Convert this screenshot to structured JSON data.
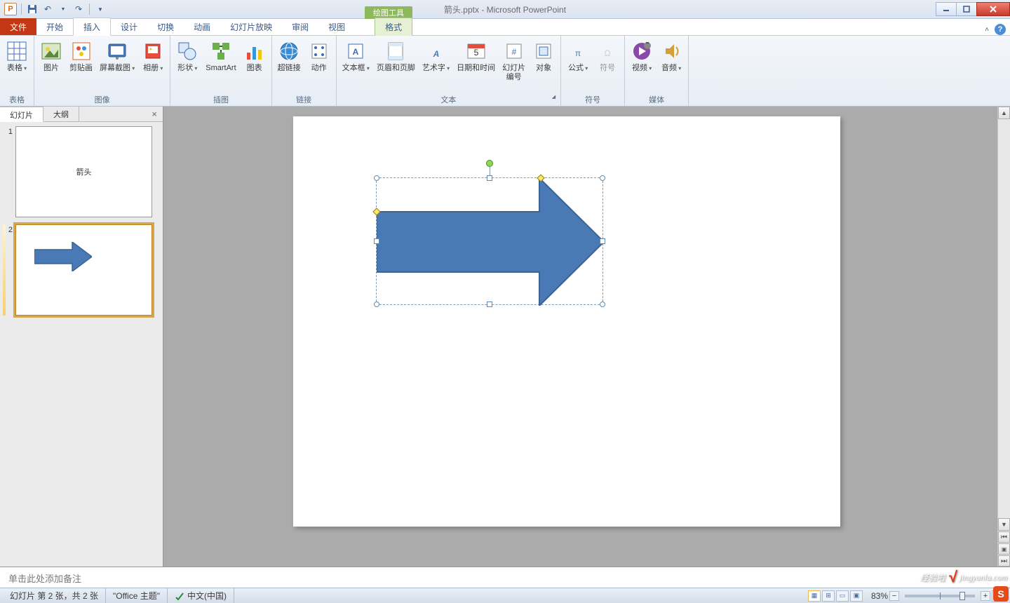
{
  "titlebar": {
    "app_letter": "P",
    "tool_context": "绘图工具",
    "title": "箭头.pptx - Microsoft PowerPoint"
  },
  "tabs": {
    "file": "文件",
    "items": [
      "开始",
      "插入",
      "设计",
      "切换",
      "动画",
      "幻灯片放映",
      "审阅",
      "视图"
    ],
    "context": "格式",
    "active_index": 1
  },
  "ribbon": {
    "groups": [
      {
        "label": "表格",
        "items": [
          {
            "label": "表格",
            "drop": true,
            "icon": "table"
          }
        ]
      },
      {
        "label": "图像",
        "items": [
          {
            "label": "图片",
            "icon": "picture"
          },
          {
            "label": "剪贴画",
            "icon": "clipart"
          },
          {
            "label": "屏幕截图",
            "drop": true,
            "icon": "screenshot"
          },
          {
            "label": "相册",
            "drop": true,
            "icon": "album"
          }
        ]
      },
      {
        "label": "插图",
        "items": [
          {
            "label": "形状",
            "drop": true,
            "icon": "shapes"
          },
          {
            "label": "SmartArt",
            "icon": "smartart"
          },
          {
            "label": "图表",
            "icon": "chart"
          }
        ]
      },
      {
        "label": "链接",
        "items": [
          {
            "label": "超链接",
            "icon": "hyperlink"
          },
          {
            "label": "动作",
            "icon": "action"
          }
        ]
      },
      {
        "label": "文本",
        "dialog": true,
        "items": [
          {
            "label": "文本框",
            "drop": true,
            "icon": "textbox"
          },
          {
            "label": "页眉和页脚",
            "icon": "headerfooter"
          },
          {
            "label": "艺术字",
            "drop": true,
            "icon": "wordart"
          },
          {
            "label": "日期和时间",
            "icon": "datetime"
          },
          {
            "label": "幻灯片\n编号",
            "icon": "slidenum"
          },
          {
            "label": "对象",
            "icon": "object"
          }
        ]
      },
      {
        "label": "符号",
        "items": [
          {
            "label": "公式",
            "drop": true,
            "icon": "equation"
          },
          {
            "label": "符号",
            "icon": "symbol",
            "disabled": true
          }
        ]
      },
      {
        "label": "媒体",
        "items": [
          {
            "label": "视频",
            "drop": true,
            "icon": "video"
          },
          {
            "label": "音频",
            "drop": true,
            "icon": "audio"
          }
        ]
      }
    ]
  },
  "panel": {
    "tab_slides": "幻灯片",
    "tab_outline": "大纲",
    "thumb1_text": "箭头"
  },
  "notes": {
    "placeholder": "单击此处添加备注"
  },
  "status": {
    "slide_info": "幻灯片 第 2 张，共 2 张",
    "theme": "\"Office 主题\"",
    "language": "中文(中国)",
    "zoom": "83%"
  },
  "watermark": "jingyanla.com"
}
